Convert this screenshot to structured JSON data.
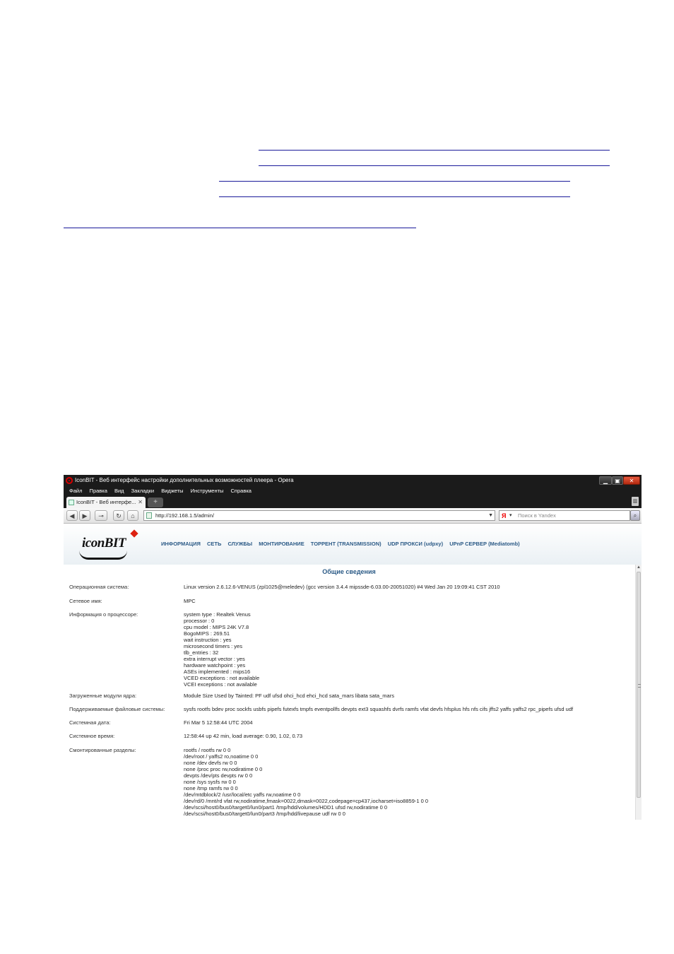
{
  "window": {
    "title": "IconBIT - Веб интерфейс настройки дополнительных возможностей плеера - Opera",
    "menu": [
      "Файл",
      "Правка",
      "Вид",
      "Закладки",
      "Виджеты",
      "Инструменты",
      "Справка"
    ],
    "tab_label": "IconBIT - Веб интерфе...",
    "address": "http://192.168.1.5/admin/",
    "search_placeholder": "Поиск в Yandex"
  },
  "page": {
    "logo_text": "iconBIT",
    "nav": [
      "ИНФОРМАЦИЯ",
      "СЕТЬ",
      "СЛУЖБЫ",
      "МОНТИРОВАНИЕ",
      "ТОРРЕНТ (TRANSMISSION)",
      "UDP ПРОКСИ (udpxy)",
      "UPnP СЕРВЕР (Mediatomb)"
    ],
    "section_title": "Общие сведения",
    "rows": [
      {
        "label": "Операционная система:",
        "lines": [
          "Linux version 2.6.12.6-VENUS (zpl1025@meledev) (gcc version 3.4.4 mipssde-6.03.00-20051020) #4 Wed Jan 20 19:09:41 CST 2010"
        ]
      },
      {
        "label": "Сетевое имя:",
        "lines": [
          "MPC"
        ]
      },
      {
        "label": "Информация о процессоре:",
        "lines": [
          "system type : Realtek Venus",
          "processor : 0",
          "cpu model : MIPS 24K V7.8",
          "BogoMIPS : 269.51",
          "wait instruction : yes",
          "microsecond timers : yes",
          "tlb_entries : 32",
          "extra interrupt vector : yes",
          "hardware watchpoint : yes",
          "ASEs implemented : mips16",
          "VCED exceptions : not available",
          "VCEI exceptions : not available"
        ]
      },
      {
        "label": "Загруженные модули ядра:",
        "lines": [
          "Module Size Used by Tainted: PF udf ufsd ohci_hcd ehci_hcd sata_mars libata sata_mars"
        ]
      },
      {
        "label": "Поддерживаемые файловые системы:",
        "lines": [
          "sysfs rootfs bdev proc sockfs usbfs pipefs futexfs tmpfs eventpollfs devpts ext3 squashfs dvrfs ramfs vfat devfs hfsplus hfs nfs cifs jffs2 yaffs yaffs2 rpc_pipefs ufsd udf"
        ]
      },
      {
        "label": "Системная дата:",
        "lines": [
          "Fri Mar 5 12:58:44 UTC 2004"
        ]
      },
      {
        "label": "Системное время:",
        "lines": [
          "12:58:44 up 42 min, load average: 0.90, 1.02, 0.73"
        ]
      },
      {
        "label": "Смонтированные разделы:",
        "lines": [
          "rootfs / rootfs rw 0 0",
          "/dev/root / yaffs2 ro,noatime 0 0",
          "none /dev devfs rw 0 0",
          "none /proc proc rw,nodiratime 0 0",
          "devpts /dev/pts devpts rw 0 0",
          "none /sys sysfs rw 0 0",
          "none /tmp ramfs rw 0 0",
          "/dev/mtdblock/2 /usr/local/etc yaffs rw,noatime 0 0",
          "/dev/rd/0 /mnt/rd vfat rw,nodiratime,fmask=0022,dmask=0022,codepage=cp437,iocharset=iso8859-1 0 0",
          "/dev/scsi/host0/bus0/target0/lun0/part1 /tmp/hdd/volumes/HDD1 ufsd rw,nodiratime 0 0",
          "/dev/scsi/host0/bus0/target0/lun0/part3 /tmp/hdd/livepause udf rw 0 0"
        ]
      }
    ]
  }
}
